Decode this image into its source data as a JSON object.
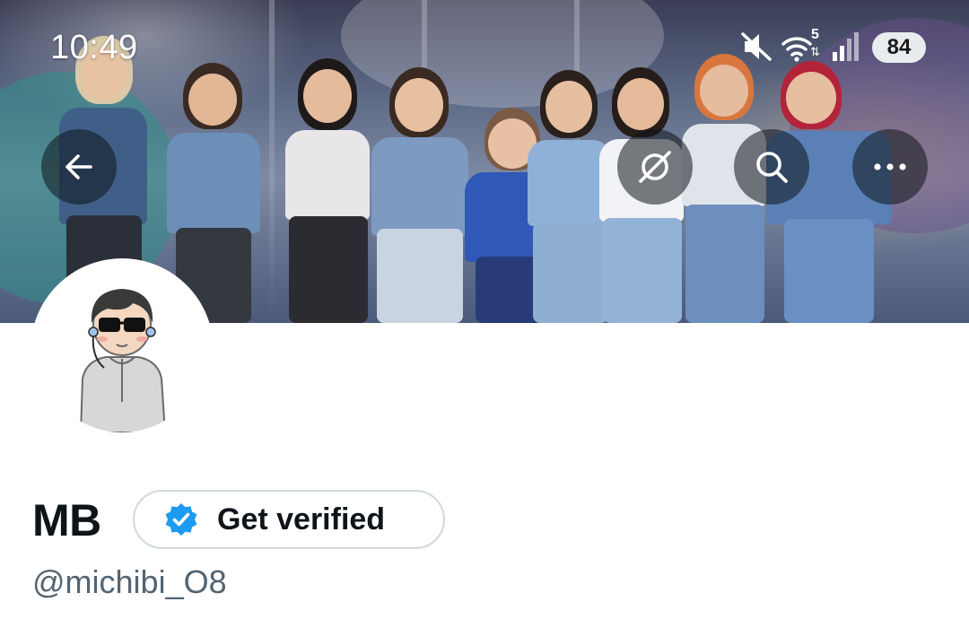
{
  "status_bar": {
    "time": "10:49",
    "wifi_label": "5",
    "battery": "84"
  },
  "header": {
    "back_icon": "arrow-left-icon",
    "grok_icon": "grok-slash-circle-icon",
    "search_icon": "search-icon",
    "more_icon": "more-horizontal-icon"
  },
  "profile": {
    "display_name": "MB",
    "get_verified_label": "Get verified",
    "handle": "@michibi_O8"
  },
  "colors": {
    "verified_blue": "#1d9bf0",
    "text_primary": "#0f1419",
    "text_secondary": "#536471",
    "button_border": "#cfd9de"
  }
}
